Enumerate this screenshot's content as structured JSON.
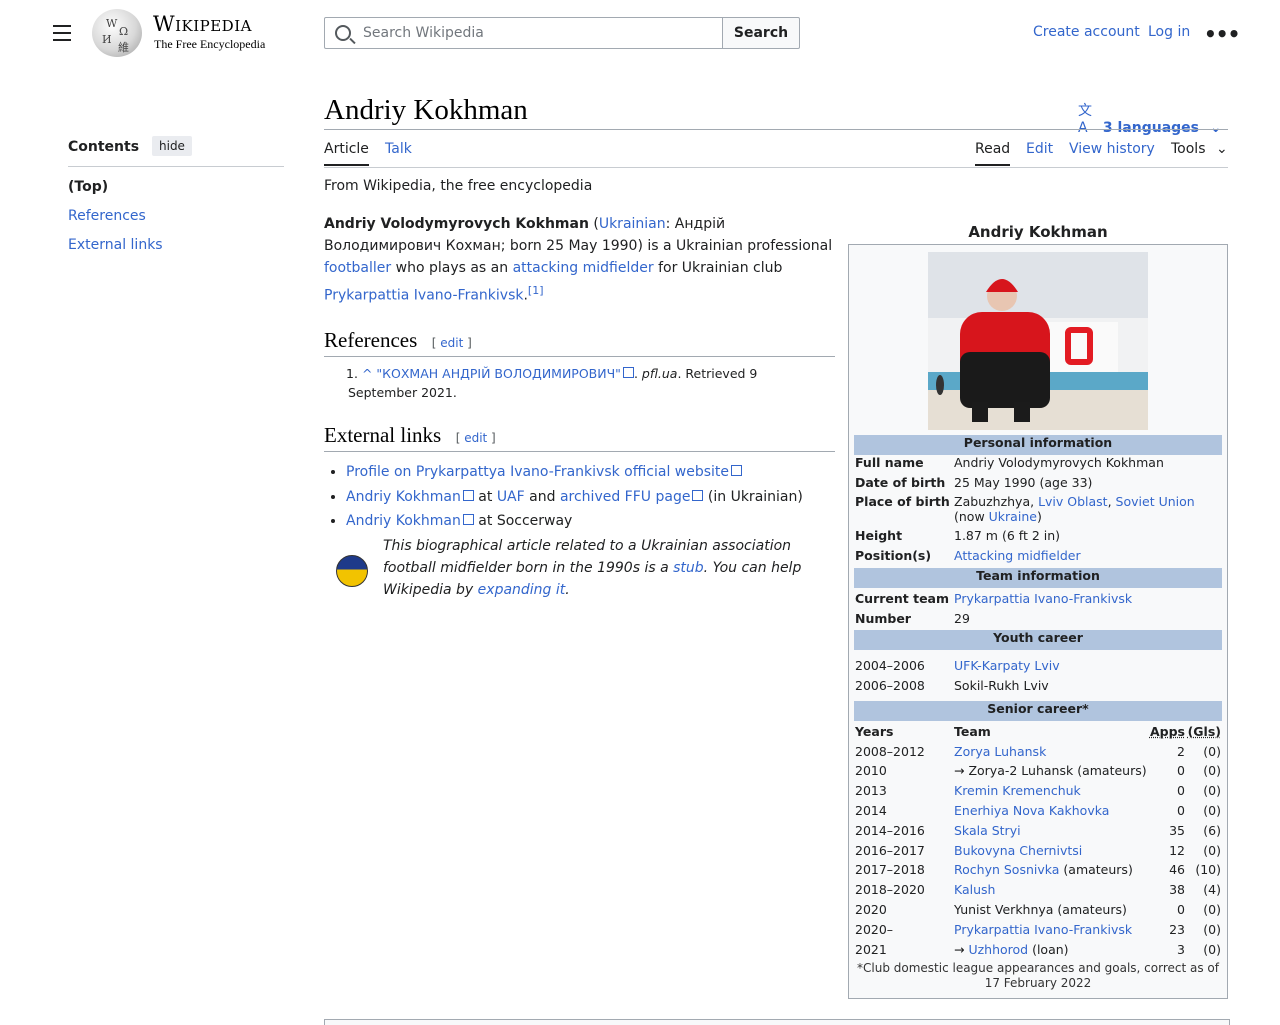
{
  "header": {
    "wordmark": "Wikipedia",
    "tagline": "The Free Encyclopedia",
    "search_placeholder": "Search Wikipedia",
    "search_button": "Search",
    "create_account": "Create account",
    "log_in": "Log in",
    "more": "•••"
  },
  "toc": {
    "title": "Contents",
    "hide": "hide",
    "items": [
      "(Top)",
      "References",
      "External links"
    ]
  },
  "page": {
    "title": "Andriy Kokhman",
    "languages": "3 languages",
    "tabs": {
      "article": "Article",
      "talk": "Talk",
      "read": "Read",
      "edit": "Edit",
      "view_history": "View history",
      "tools": "Tools"
    },
    "from": "From Wikipedia, the free encyclopedia"
  },
  "lead": {
    "name_bold": "Andriy Volodymyrovych Kokhman",
    "p1": " (",
    "ukrainian": "Ukrainian",
    "p2": ": Андрій Володимирович Кохман; born 25 May 1990) is a Ukrainian professional ",
    "footballer": "footballer",
    "p3": " who plays as an ",
    "attacking_midfielder": "attacking midfielder",
    "p4": " for Ukrainian club ",
    "club": "Prykarpattia Ivano-Frankivsk",
    "p5": ".",
    "cite": "[1]"
  },
  "references": {
    "heading": "References",
    "edit": "edit",
    "num": "1.",
    "caret": "^",
    "link": "\"КОХМАН АНДРІЙ ВОЛОДИМИРОВИЧ\"",
    "source": "pfl.ua",
    "retrieved": ". Retrieved 9 September 2021."
  },
  "external_links": {
    "heading": "External links",
    "edit": "edit",
    "item1": "Profile on Prykarpattya Ivano-Frankivsk official website",
    "item2_link": "Andriy Kokhman",
    "item2_at": " at ",
    "item2_uaf": "UAF",
    "item2_and": " and ",
    "item2_ffu": "archived FFU page",
    "item2_tail": " (in Ukrainian)",
    "item3_link": "Andriy Kokhman",
    "item3_tail": " at Soccerway"
  },
  "stub": {
    "t1": "This biographical article related to a Ukrainian association football midfielder born in the 1990s is a ",
    "stub_link": "stub",
    "t2": ". You can help Wikipedia by ",
    "expand_link": "expanding it",
    "t3": "."
  },
  "infobox": {
    "caption": "Andriy Kokhman",
    "personal_heading": "Personal information",
    "full_name_label": "Full name",
    "full_name": "Andriy Volodymyrovych Kokhman",
    "dob_label": "Date of birth",
    "dob": "25 May 1990 (age 33)",
    "pob_label": "Place of birth",
    "pob_1": "Zabuzhzhya, ",
    "pob_oblast": "Lviv Oblast",
    "pob_sep": ", ",
    "pob_su": "Soviet Union",
    "pob_now": "(now ",
    "pob_ukraine": "Ukraine",
    "pob_close": ")",
    "height_label": "Height",
    "height": "1.87 m (6 ft 2 in)",
    "position_label": "Position(s)",
    "position": "Attacking midfielder",
    "team_heading": "Team information",
    "current_team_label": "Current team",
    "current_team": "Prykarpattia Ivano-Frankivsk",
    "number_label": "Number",
    "number": "29",
    "youth_heading": "Youth career",
    "youth": [
      {
        "years": "2004–2006",
        "team": "UFK-Karpaty Lviv",
        "link": true
      },
      {
        "years": "2006–2008",
        "team": "Sokil-Rukh Lviv",
        "link": false
      }
    ],
    "senior_heading": "Senior career*",
    "col_years": "Years",
    "col_team": "Team",
    "col_apps": "Apps",
    "col_gls": "(Gls)",
    "senior": [
      {
        "years": "2008–2012",
        "team": "Zorya Luhansk",
        "suffix": "",
        "prefix": "",
        "apps": "2",
        "gls": "(0)",
        "link": true
      },
      {
        "years": "2010",
        "team": "Zorya-2 Luhansk (amateurs)",
        "suffix": "",
        "prefix": "→ ",
        "apps": "0",
        "gls": "(0)",
        "link": false
      },
      {
        "years": "2013",
        "team": "Kremin Kremenchuk",
        "suffix": "",
        "prefix": "",
        "apps": "0",
        "gls": "(0)",
        "link": true
      },
      {
        "years": "2014",
        "team": "Enerhiya Nova Kakhovka",
        "suffix": "",
        "prefix": "",
        "apps": "0",
        "gls": "(0)",
        "link": true
      },
      {
        "years": "2014–2016",
        "team": "Skala Stryi",
        "suffix": "",
        "prefix": "",
        "apps": "35",
        "gls": "(6)",
        "link": true
      },
      {
        "years": "2016–2017",
        "team": "Bukovyna Chernivtsi",
        "suffix": "",
        "prefix": "",
        "apps": "12",
        "gls": "(0)",
        "link": true
      },
      {
        "years": "2017–2018",
        "team": "Rochyn Sosnivka",
        "suffix": " (amateurs)",
        "prefix": "",
        "apps": "46",
        "gls": "(10)",
        "link": true
      },
      {
        "years": "2018–2020",
        "team": "Kalush",
        "suffix": "",
        "prefix": "",
        "apps": "38",
        "gls": "(4)",
        "link": true
      },
      {
        "years": "2020",
        "team": "Yunist Verkhnya (amateurs)",
        "suffix": "",
        "prefix": "",
        "apps": "0",
        "gls": "(0)",
        "link": false
      },
      {
        "years": "2020–",
        "team": "Prykarpattia Ivano-Frankivsk",
        "suffix": "",
        "prefix": "",
        "apps": "23",
        "gls": "(0)",
        "link": true
      },
      {
        "years": "2021",
        "team": "Uzhhorod",
        "suffix": " (loan)",
        "prefix": "→ ",
        "apps": "3",
        "gls": "(0)",
        "link": true
      }
    ],
    "footnote": "*Club domestic league appearances and goals, correct as of 17 February 2022"
  }
}
